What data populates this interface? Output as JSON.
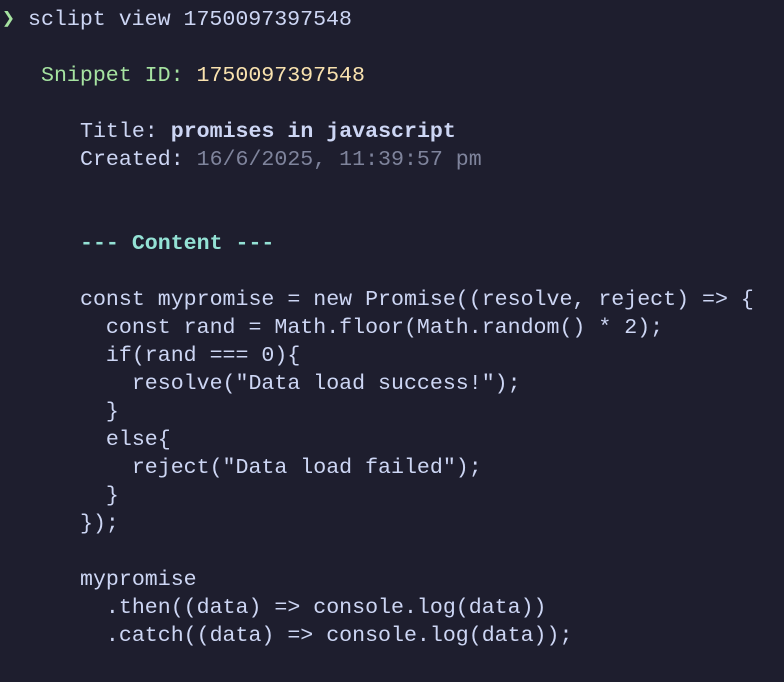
{
  "prompt": {
    "symbol": "❯",
    "command": "sclipt view 1750097397548"
  },
  "snippet": {
    "id_label": "Snippet ID:",
    "id_value": "1750097397548"
  },
  "meta": {
    "title_label": "Title:",
    "title_value": "promises in javascript",
    "created_label": "Created:",
    "created_value": "16/6/2025, 11:39:57 pm"
  },
  "content_header": "--- Content ---",
  "code_lines": [
    "const mypromise = new Promise((resolve, reject) => {",
    "  const rand = Math.floor(Math.random() * 2);",
    "  if(rand === 0){",
    "    resolve(\"Data load success!\");",
    "  }",
    "  else{",
    "    reject(\"Data load failed\");",
    "  }",
    "});",
    "",
    "mypromise",
    "  .then((data) => console.log(data))",
    "  .catch((data) => console.log(data));"
  ]
}
